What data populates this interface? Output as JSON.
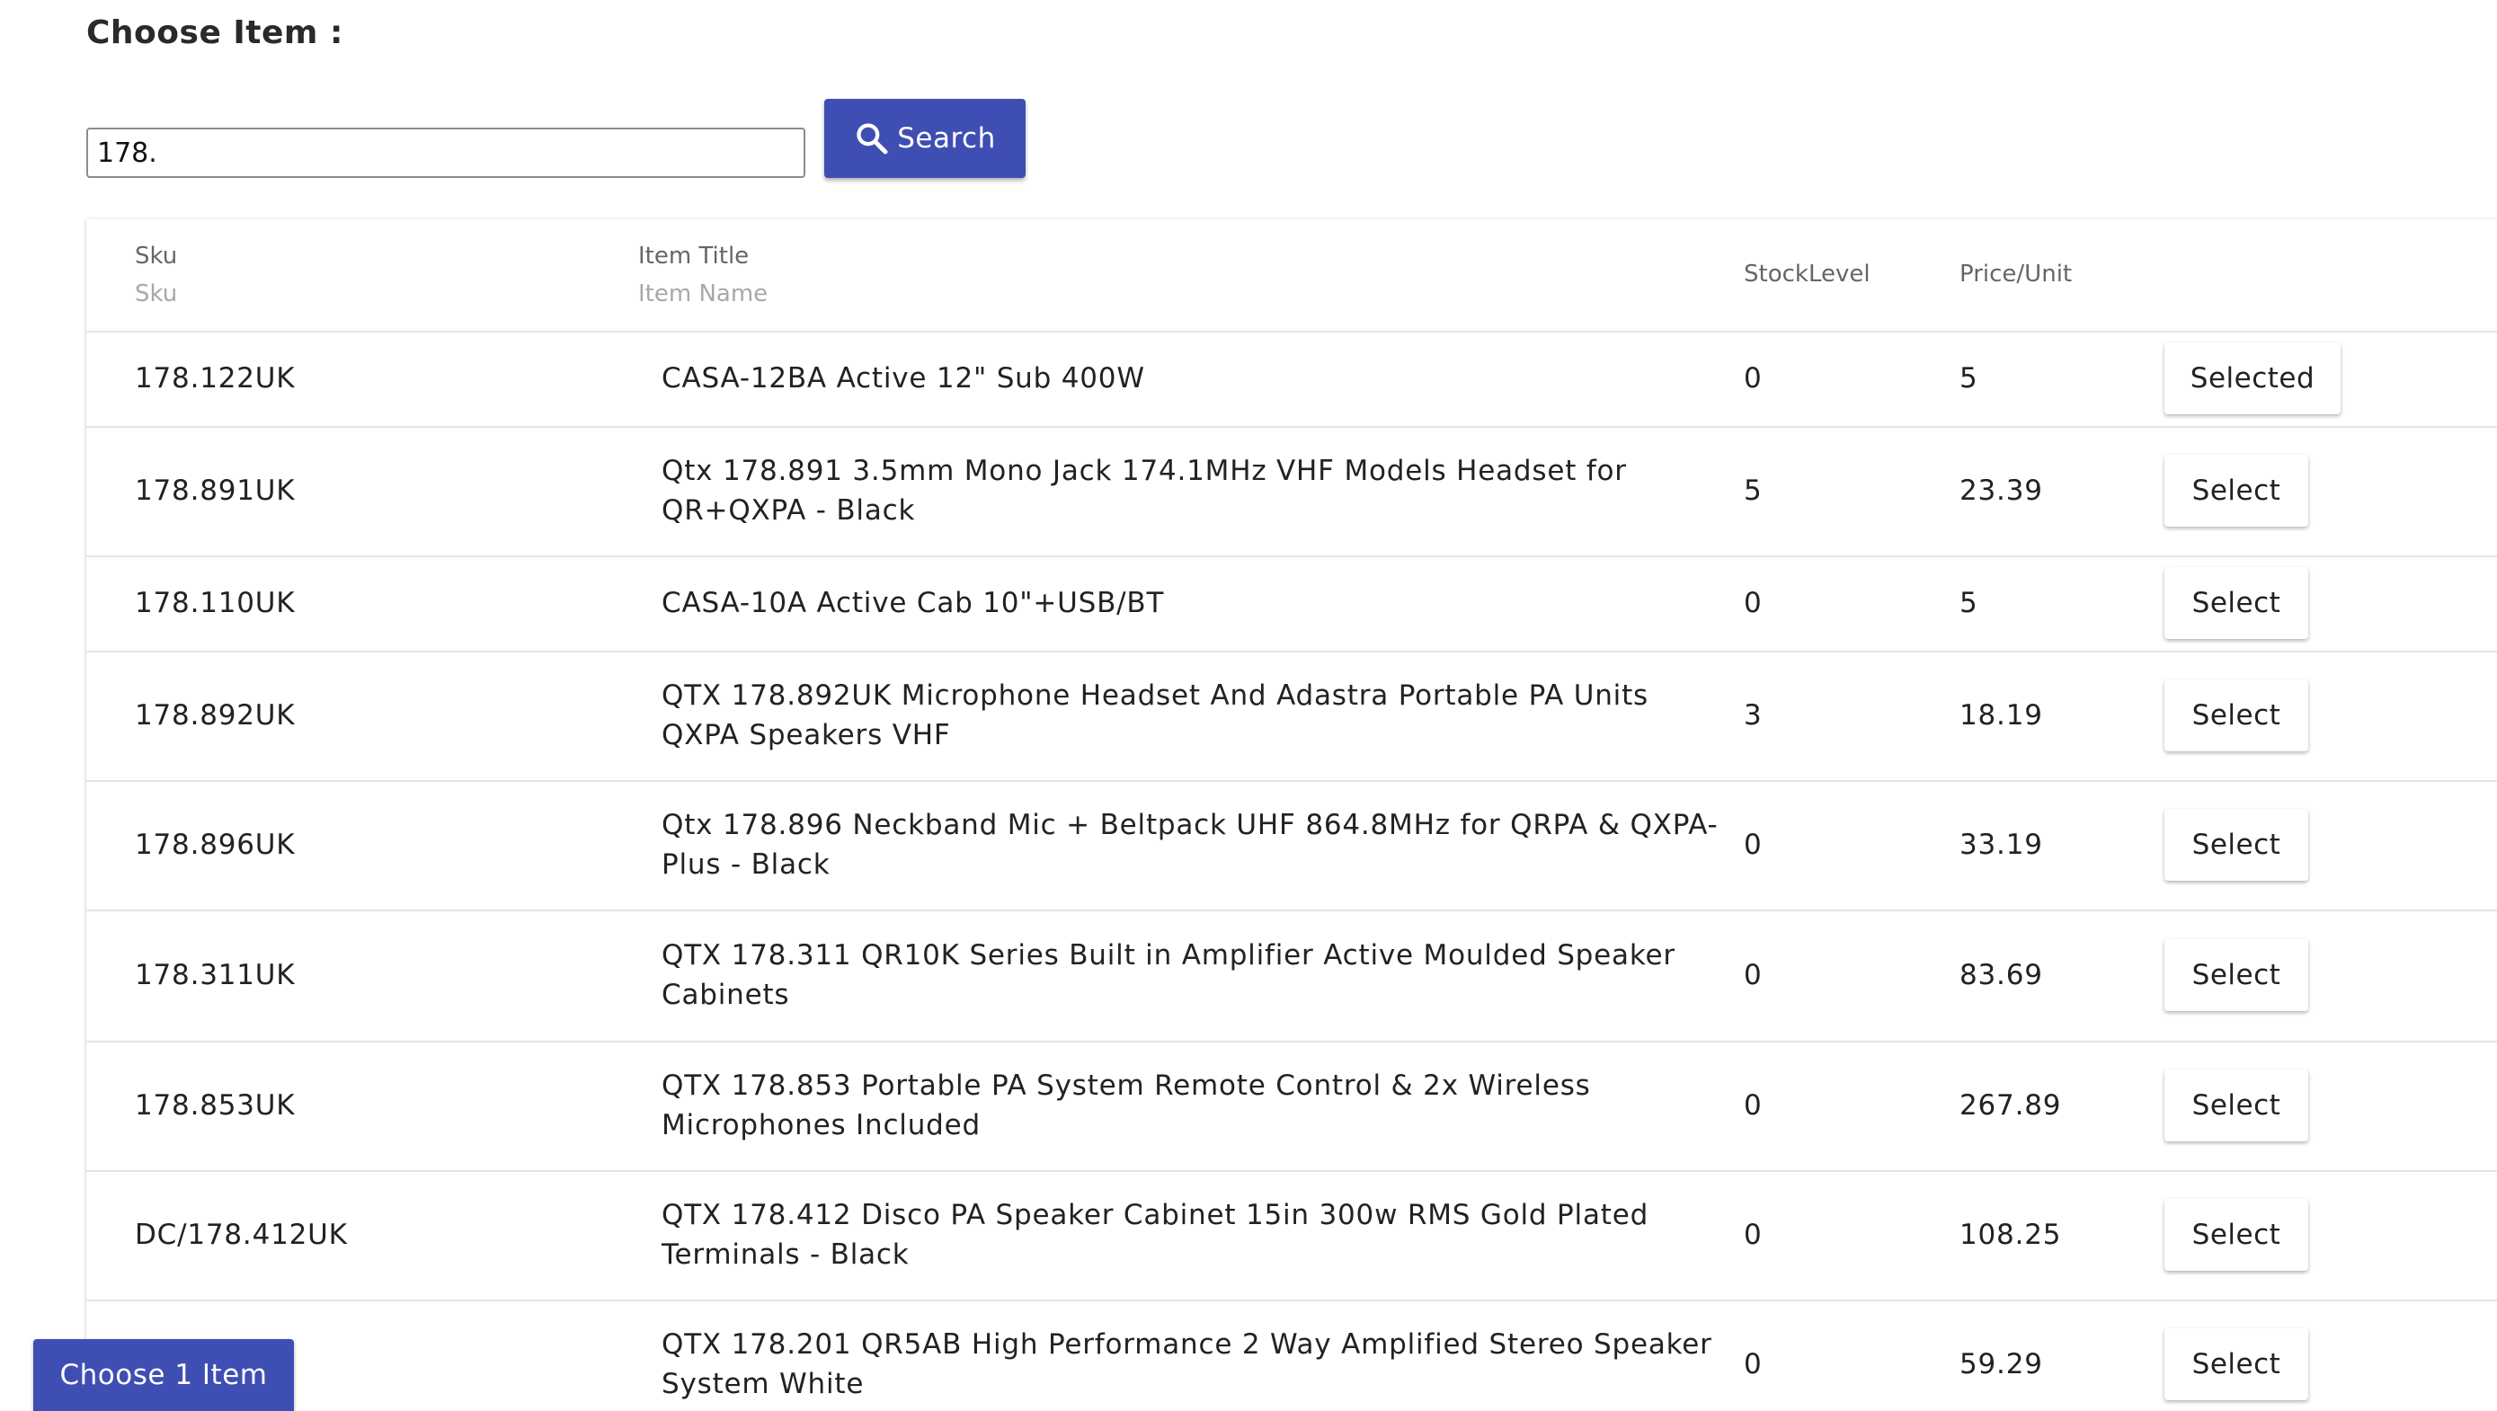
{
  "heading": "Choose Item :",
  "search": {
    "value": "178.",
    "button_label": "Search"
  },
  "table": {
    "columns": {
      "sku": "Sku",
      "sku_sub": "Sku",
      "title": "Item Title",
      "title_sub": "Item Name",
      "stock": "StockLevel",
      "price": "Price/Unit"
    },
    "rows": [
      {
        "sku": "178.122UK",
        "title": "CASA-12BA Active 12\" Sub 400W",
        "stock": "0",
        "price": "5",
        "action": "Selected"
      },
      {
        "sku": "178.891UK",
        "title": "Qtx 178.891 3.5mm Mono Jack 174.1MHz VHF Models Headset for QR+QXPA - Black",
        "stock": "5",
        "price": "23.39",
        "action": "Select"
      },
      {
        "sku": "178.110UK",
        "title": "CASA-10A Active Cab 10\"+USB/BT",
        "stock": "0",
        "price": "5",
        "action": "Select"
      },
      {
        "sku": "178.892UK",
        "title": "QTX 178.892UK Microphone Headset And Adastra Portable PA Units QXPA Speakers VHF",
        "stock": "3",
        "price": "18.19",
        "action": "Select"
      },
      {
        "sku": "178.896UK",
        "title": "Qtx 178.896 Neckband Mic + Beltpack UHF 864.8MHz for QRPA & QXPA-Plus - Black",
        "stock": "0",
        "price": "33.19",
        "action": "Select"
      },
      {
        "sku": "178.311UK",
        "title": "QTX 178.311 QR10K Series Built in Amplifier Active Moulded Speaker Cabinets",
        "stock": "0",
        "price": "83.69",
        "action": "Select"
      },
      {
        "sku": "178.853UK",
        "title": "QTX 178.853 Portable PA System Remote Control & 2x Wireless Microphones Included",
        "stock": "0",
        "price": "267.89",
        "action": "Select"
      },
      {
        "sku": "DC/178.412UK",
        "title": "QTX 178.412 Disco PA Speaker Cabinet 15in 300w RMS Gold Plated Terminals - Black",
        "stock": "0",
        "price": "108.25",
        "action": "Select"
      },
      {
        "sku": "",
        "title": "QTX 178.201 QR5AB High Performance 2 Way Amplified Stereo Speaker System White",
        "stock": "0",
        "price": "59.29",
        "action": "Select"
      }
    ]
  },
  "footer": {
    "choose_label": "Choose 1 Item"
  },
  "colors": {
    "primary": "#3f4eb2"
  },
  "icons": {
    "search_button": "search-icon"
  }
}
